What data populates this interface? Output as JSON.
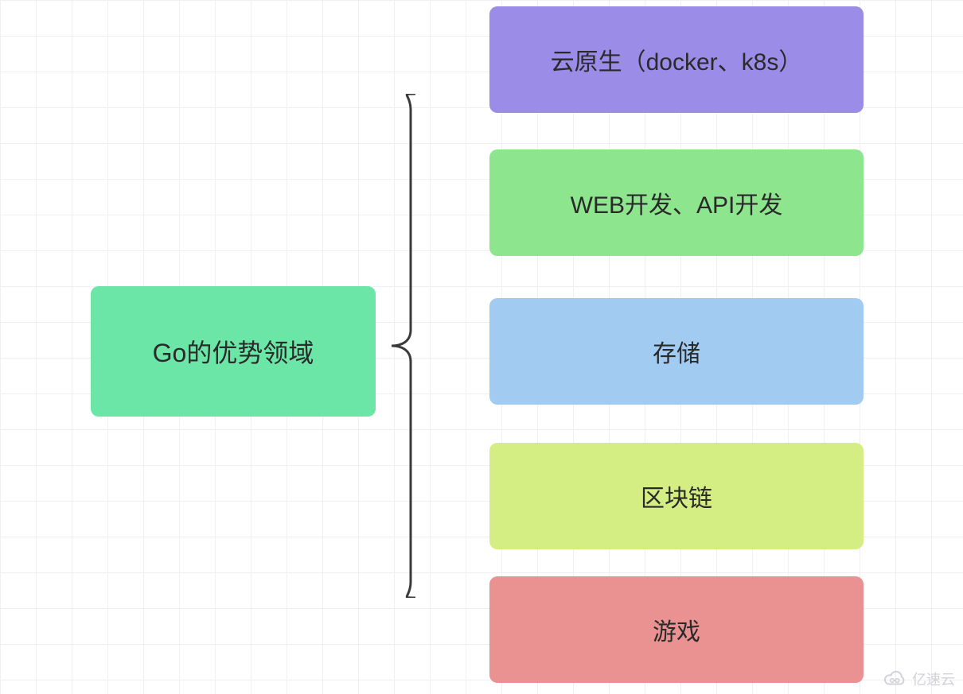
{
  "root": {
    "label": "Go的优势领域"
  },
  "children": [
    {
      "label": "云原生（docker、k8s）",
      "color": "#9b8ce8"
    },
    {
      "label": "WEB开发、API开发",
      "color": "#8de58e"
    },
    {
      "label": "存储",
      "color": "#a2cbf2"
    },
    {
      "label": "区块链",
      "color": "#d4ee84"
    },
    {
      "label": "游戏",
      "color": "#ea9291"
    }
  ],
  "watermark": {
    "text": "亿速云"
  }
}
